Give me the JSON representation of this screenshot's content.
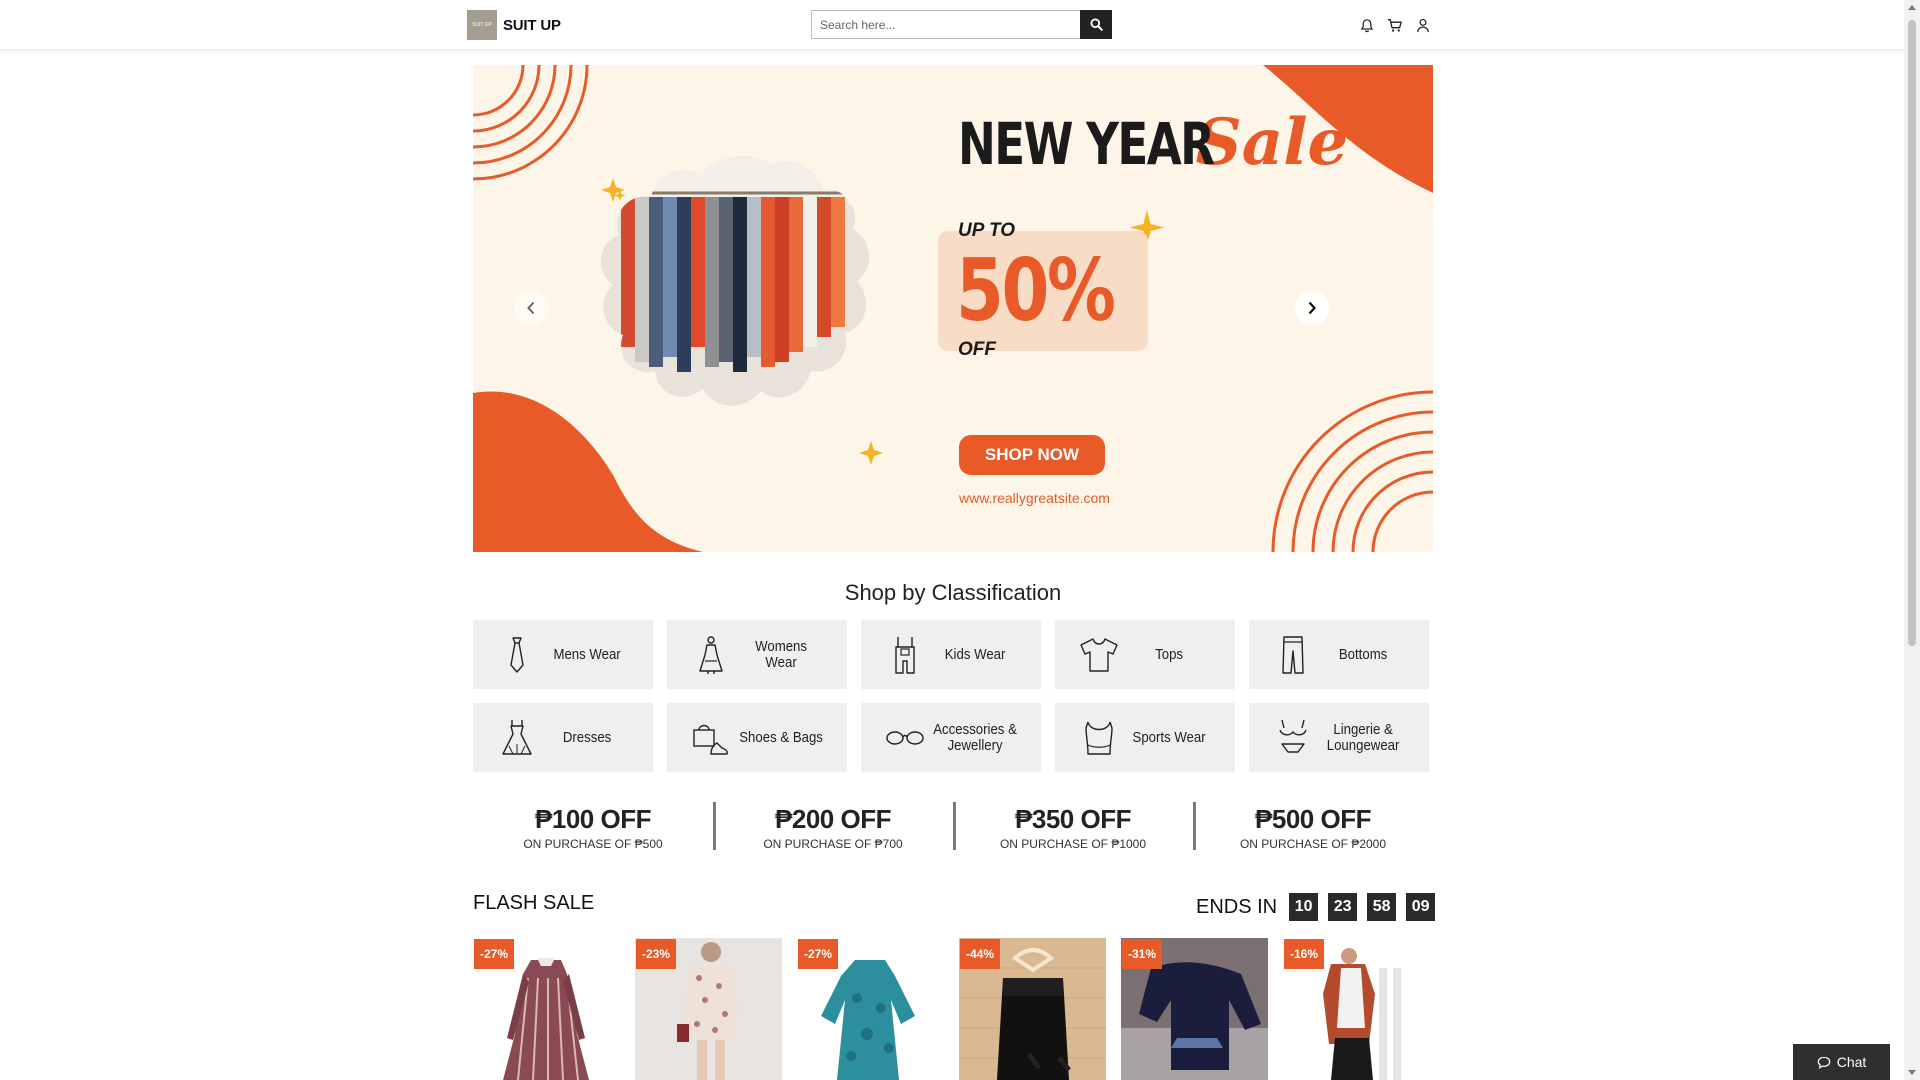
{
  "header": {
    "logo_box_text": "SUIT UP",
    "brand": "SUIT UP",
    "search_placeholder": "Search here...",
    "icons": [
      "bell-icon",
      "cart-icon",
      "user-icon",
      "search-icon"
    ]
  },
  "banner": {
    "title_main": "NEW YEAR",
    "title_script": "Sale",
    "upto": "UP TO",
    "percent": "50%",
    "off": "OFF",
    "cta": "SHOP NOW",
    "url": "www.reallygreatsite.com",
    "accent_color": "#e85a28",
    "bg_color": "#fdf6e8"
  },
  "classification": {
    "title": "Shop by Classification",
    "items": [
      {
        "label": "Mens Wear",
        "icon": "tie-icon"
      },
      {
        "label": "Womens Wear",
        "icon": "woman-dress-icon"
      },
      {
        "label": "Kids Wear",
        "icon": "overalls-icon"
      },
      {
        "label": "Tops",
        "icon": "tshirt-icon"
      },
      {
        "label": "Bottoms",
        "icon": "pants-icon"
      },
      {
        "label": "Dresses",
        "icon": "dress-icon"
      },
      {
        "label": "Shoes & Bags",
        "icon": "shoes-bag-icon"
      },
      {
        "label": "Accessories & Jewellery",
        "icon": "glasses-icon"
      },
      {
        "label": "Sports Wear",
        "icon": "sports-top-icon"
      },
      {
        "label": "Lingerie & Loungewear",
        "icon": "lingerie-icon"
      }
    ]
  },
  "discounts": [
    {
      "amount": "₱100 OFF",
      "condition": "ON PURCHASE OF ₱500"
    },
    {
      "amount": "₱200 OFF",
      "condition": "ON PURCHASE OF ₱700"
    },
    {
      "amount": "₱350 OFF",
      "condition": "ON PURCHASE OF ₱1000"
    },
    {
      "amount": "₱500 OFF",
      "condition": "ON PURCHASE OF ₱2000"
    }
  ],
  "flash_sale": {
    "title": "FLASH SALE",
    "ends_label": "ENDS IN",
    "timer": [
      "10",
      "23",
      "58",
      "09"
    ],
    "products": [
      {
        "badge": "-27%"
      },
      {
        "badge": "-23%"
      },
      {
        "badge": "-27%"
      },
      {
        "badge": "-44%"
      },
      {
        "badge": "-31%"
      },
      {
        "badge": "-16%"
      }
    ]
  },
  "chat": {
    "label": "Chat"
  }
}
